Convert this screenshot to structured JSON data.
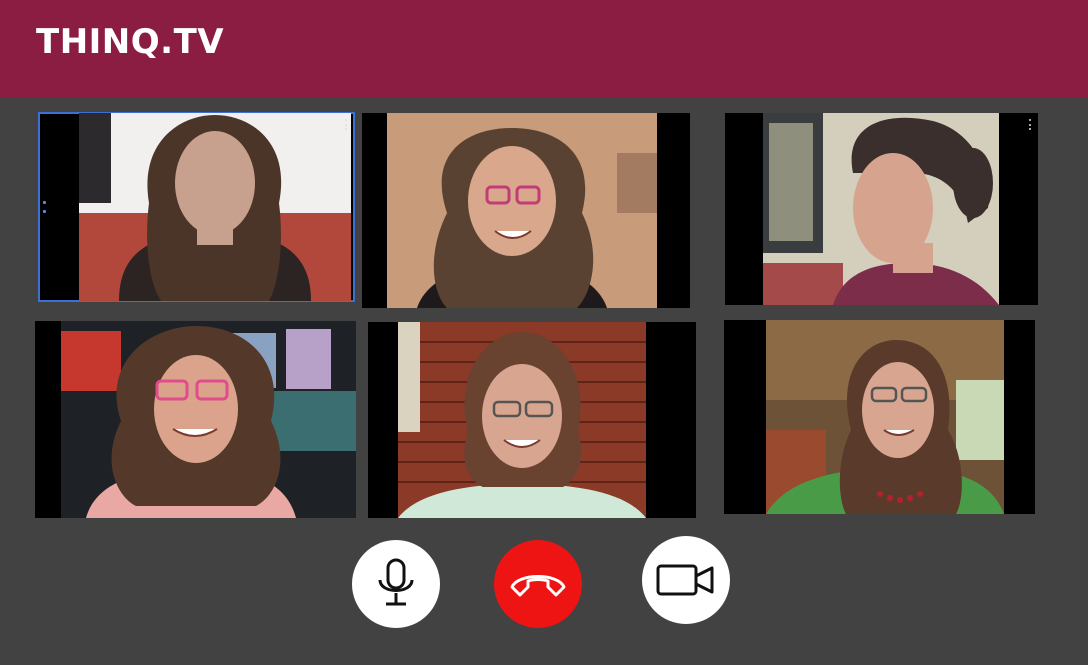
{
  "app": {
    "brand": "THINQ.TV"
  },
  "colors": {
    "header": "#8b1c42",
    "background": "#424242",
    "end_call": "#ee1414",
    "active_outline": "#3d6fd6"
  },
  "participants": [
    {
      "label": "participant-1",
      "active": true
    },
    {
      "label": "participant-2",
      "active": false
    },
    {
      "label": "participant-3",
      "active": false
    },
    {
      "label": "participant-4",
      "active": false
    },
    {
      "label": "participant-5",
      "active": false
    },
    {
      "label": "participant-6",
      "active": false
    }
  ],
  "controls": {
    "microphone": "microphone-icon",
    "end_call": "phone-hangup-icon",
    "camera": "video-camera-icon"
  }
}
